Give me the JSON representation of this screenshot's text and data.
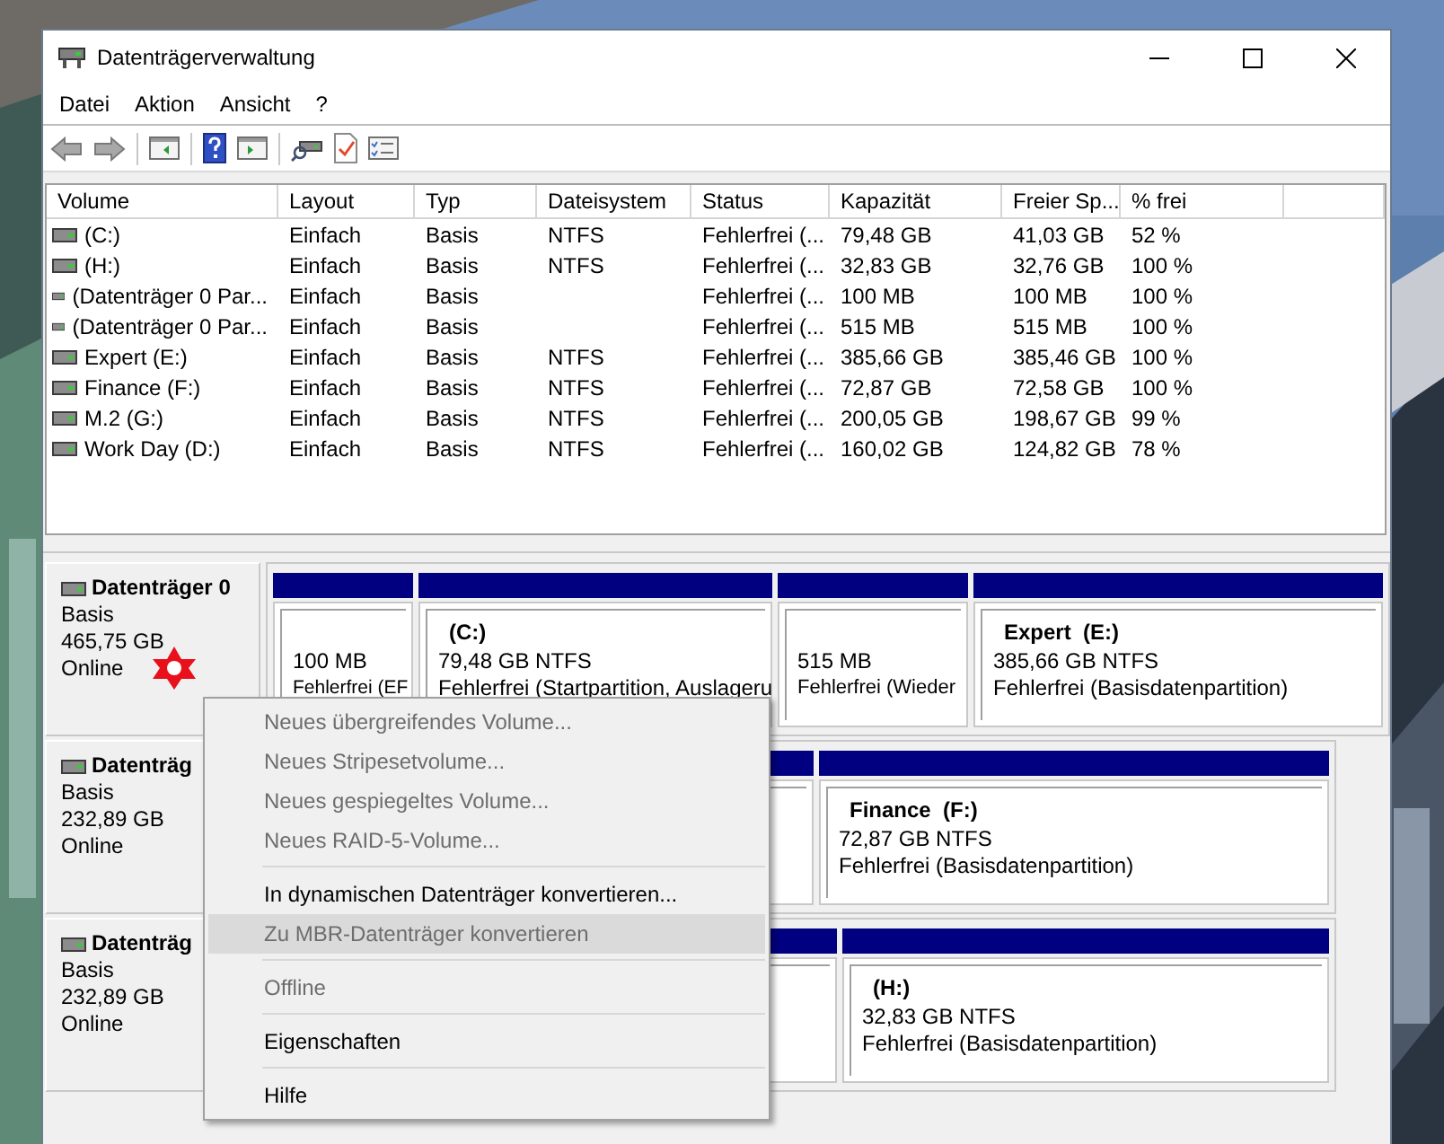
{
  "window": {
    "title": "Datenträgerverwaltung"
  },
  "menu_bar": [
    "Datei",
    "Aktion",
    "Ansicht",
    "?"
  ],
  "volume_table": {
    "columns": [
      "Volume",
      "Layout",
      "Typ",
      "Dateisystem",
      "Status",
      "Kapazität",
      "Freier Sp...",
      "% frei"
    ],
    "rows": [
      {
        "volume": "(C:)",
        "layout": "Einfach",
        "type": "Basis",
        "filesystem": "NTFS",
        "status": "Fehlerfrei (...",
        "capacity": "79,48 GB",
        "free": "41,03 GB",
        "percent_free": "52 %"
      },
      {
        "volume": "(H:)",
        "layout": "Einfach",
        "type": "Basis",
        "filesystem": "NTFS",
        "status": "Fehlerfrei (...",
        "capacity": "32,83 GB",
        "free": "32,76 GB",
        "percent_free": "100 %"
      },
      {
        "volume": "(Datenträger 0 Par...",
        "layout": "Einfach",
        "type": "Basis",
        "status": "Fehlerfrei (...",
        "capacity": "100 MB",
        "free": "100 MB",
        "percent_free": "100 %"
      },
      {
        "volume": "(Datenträger 0 Par...",
        "layout": "Einfach",
        "type": "Basis",
        "status": "Fehlerfrei (...",
        "capacity": "515 MB",
        "free": "515 MB",
        "percent_free": "100 %"
      },
      {
        "volume": "Expert (E:)",
        "layout": "Einfach",
        "type": "Basis",
        "filesystem": "NTFS",
        "status": "Fehlerfrei (...",
        "capacity": "385,66 GB",
        "free": "385,46 GB",
        "percent_free": "100 %"
      },
      {
        "volume": "Finance (F:)",
        "layout": "Einfach",
        "type": "Basis",
        "filesystem": "NTFS",
        "status": "Fehlerfrei (...",
        "capacity": "72,87 GB",
        "free": "72,58 GB",
        "percent_free": "100 %"
      },
      {
        "volume": "M.2 (G:)",
        "layout": "Einfach",
        "type": "Basis",
        "filesystem": "NTFS",
        "status": "Fehlerfrei (...",
        "capacity": "200,05 GB",
        "free": "198,67 GB",
        "percent_free": "99 %"
      },
      {
        "volume": "Work Day (D:)",
        "layout": "Einfach",
        "type": "Basis",
        "filesystem": "NTFS",
        "status": "Fehlerfrei (...",
        "capacity": "160,02 GB",
        "free": "124,82 GB",
        "percent_free": "78 %"
      }
    ]
  },
  "disks": [
    {
      "name": "Datenträger 0",
      "type": "Basis",
      "size": "465,75 GB",
      "status": "Online",
      "partitions": [
        {
          "kind": "volume",
          "size": "100 MB",
          "status": "Fehlerfrei (EF"
        },
        {
          "kind": "volume",
          "name": "(C:)",
          "size": "79,48 GB NTFS",
          "status": "Fehlerfrei (Startpartition, Auslageru"
        },
        {
          "kind": "volume",
          "size": "515 MB",
          "status": "Fehlerfrei (Wieder"
        },
        {
          "kind": "volume",
          "name": "Expert  (E:)",
          "size": "385,66 GB NTFS",
          "status": "Fehlerfrei (Basisdatenpartition)"
        }
      ]
    },
    {
      "name": "Datenträg",
      "type": "Basis",
      "size": "232,89 GB",
      "status": "Online",
      "partitions": [
        {
          "kind": "covered"
        },
        {
          "kind": "volume",
          "name": "Finance  (F:)",
          "size": "72,87 GB NTFS",
          "status": "Fehlerfrei (Basisdatenpartition)"
        }
      ]
    },
    {
      "name": "Datenträg",
      "type": "Basis",
      "size": "232,89 GB",
      "status": "Online",
      "partitions": [
        {
          "kind": "covered"
        },
        {
          "kind": "volume",
          "name": "(H:)",
          "size": "32,83 GB NTFS",
          "status": "Fehlerfrei (Basisdatenpartition)"
        }
      ]
    }
  ],
  "context_menu": {
    "items": [
      {
        "kind": "item",
        "label": "Neues übergreifendes Volume...",
        "disabled": true,
        "selected": false
      },
      {
        "kind": "item",
        "label": "Neues Stripesetvolume...",
        "disabled": true,
        "selected": false
      },
      {
        "kind": "item",
        "label": "Neues gespiegeltes Volume...",
        "disabled": true,
        "selected": false
      },
      {
        "kind": "item",
        "label": "Neues RAID-5-Volume...",
        "disabled": true,
        "selected": false
      },
      {
        "kind": "separator"
      },
      {
        "kind": "item",
        "label": "In dynamischen Datenträger konvertieren...",
        "disabled": false,
        "selected": false
      },
      {
        "kind": "item",
        "label": "Zu MBR-Datenträger konvertieren",
        "disabled": true,
        "selected": true
      },
      {
        "kind": "separator"
      },
      {
        "kind": "item",
        "label": "Offline",
        "disabled": true,
        "selected": false
      },
      {
        "kind": "separator"
      },
      {
        "kind": "item",
        "label": "Eigenschaften",
        "disabled": false,
        "selected": false
      },
      {
        "kind": "separator"
      },
      {
        "kind": "item",
        "label": "Hilfe",
        "disabled": false,
        "selected": false
      }
    ]
  }
}
